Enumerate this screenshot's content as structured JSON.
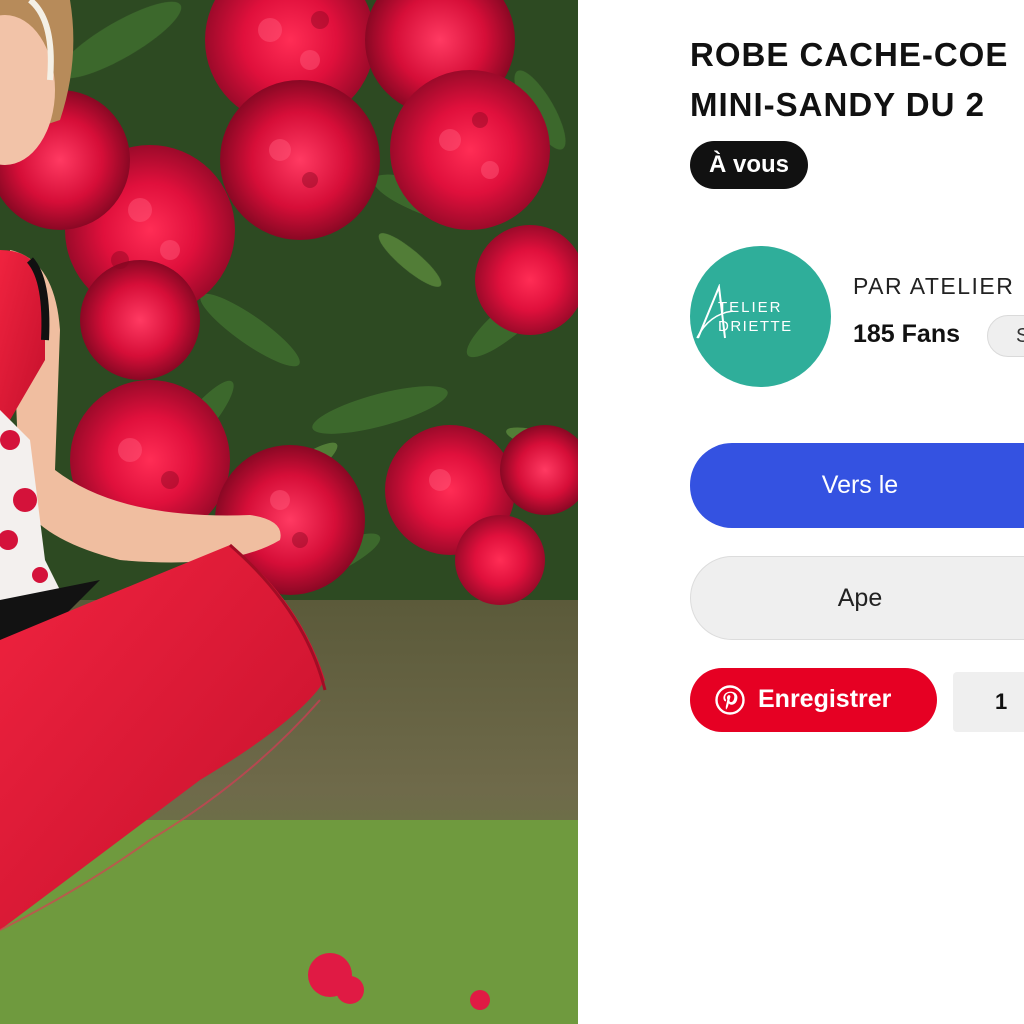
{
  "product": {
    "title_line1": "ROBE CACHE-COE",
    "title_line2": "MINI-SANDY DU 2",
    "tag": "À vous"
  },
  "designer": {
    "logo_text_line1": "TELIER",
    "logo_text_line2": "DRIETTE",
    "by_label": "PAR ATELIER",
    "fans": "185 Fans",
    "follow_label": "S"
  },
  "actions": {
    "primary_label": "Vers le",
    "secondary_label": "Ape",
    "pinterest_label": "Enregistrer",
    "pinterest_count": "1"
  },
  "colors": {
    "primary": "#3452e1",
    "pinterest": "#e60023",
    "avatar": "#2fae9a",
    "tag_bg": "#111111"
  },
  "icons": {
    "pinterest": "pinterest-icon"
  }
}
